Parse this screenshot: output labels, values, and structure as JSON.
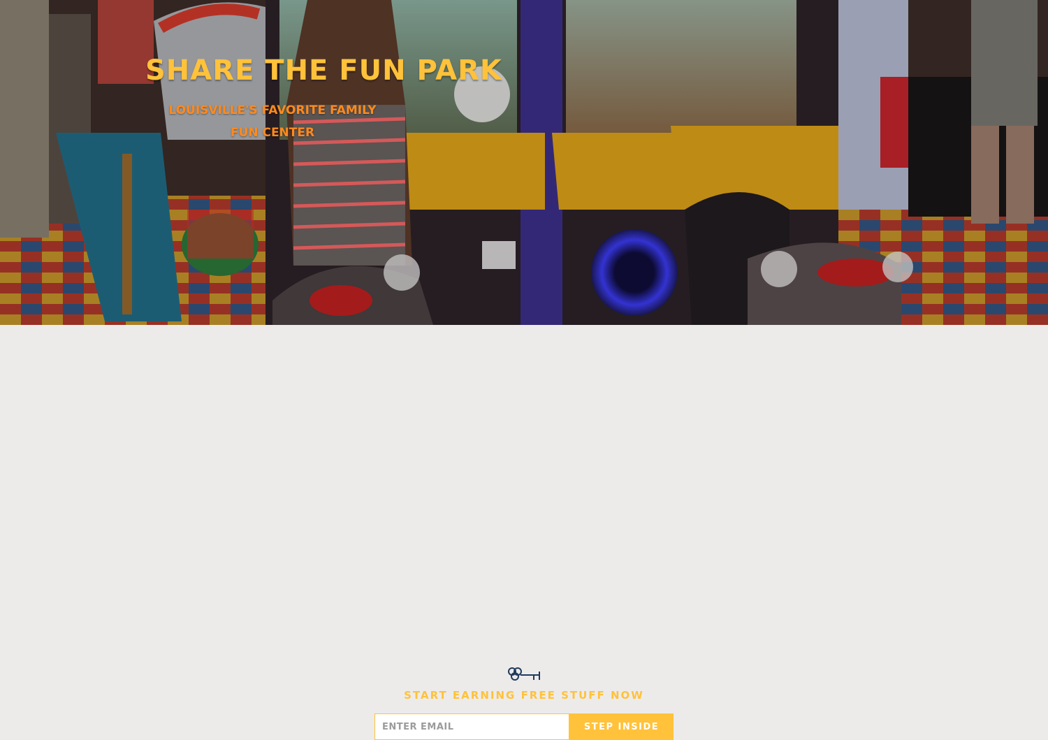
{
  "hero": {
    "title": "Share the Fun Park",
    "subtitle": "Louisville's Favorite Family Fun Center",
    "background_image": "arcade-racing-machines-photo"
  },
  "signup": {
    "icon": "key-icon",
    "tagline": "Start Earning Free Stuff Now",
    "email_placeholder": "Enter Email",
    "email_value": "",
    "submit_label": "Step Inside"
  },
  "colors": {
    "accent_yellow": "#ffc23a",
    "accent_orange": "#ff8a1e",
    "icon_navy": "#1f3a5c",
    "page_background": "#edebea"
  }
}
